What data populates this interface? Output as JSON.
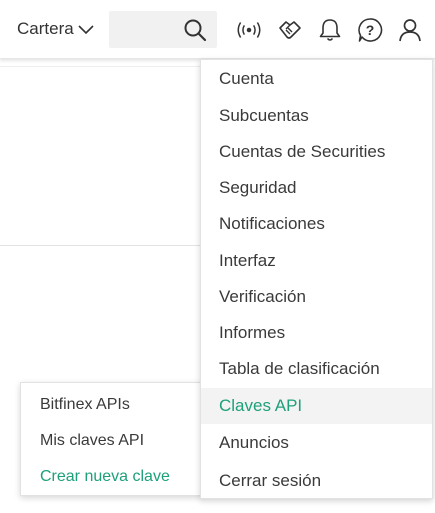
{
  "header": {
    "wallet_label": "Cartera",
    "search": {
      "value": "",
      "placeholder": ""
    },
    "icons": [
      "chevron-down-icon",
      "search-icon",
      "broadcast-icon",
      "handshake-icon",
      "bell-icon",
      "help-icon",
      "user-icon"
    ]
  },
  "account_menu": {
    "items": [
      {
        "label": "Cuenta"
      },
      {
        "label": "Subcuentas"
      },
      {
        "label": "Cuentas de Securities"
      },
      {
        "label": "Seguridad"
      },
      {
        "label": "Notificaciones"
      },
      {
        "label": "Interfaz"
      },
      {
        "label": "Verificación"
      },
      {
        "label": "Informes"
      },
      {
        "label": "Tabla de clasificación"
      },
      {
        "label": "Claves API"
      },
      {
        "label": "Anuncios"
      },
      {
        "label": "Cerrar sesión"
      }
    ],
    "active_item": "Claves API"
  },
  "api_submenu": {
    "items": [
      {
        "label": "Bitfinex APIs"
      },
      {
        "label": "Mis claves API"
      },
      {
        "label": "Crear nueva clave"
      }
    ]
  },
  "colors": {
    "accent": "#1ea07a",
    "text": "#3a3a3a",
    "hover_bg": "#f3f3f3",
    "search_bg": "#f1f1f1"
  }
}
